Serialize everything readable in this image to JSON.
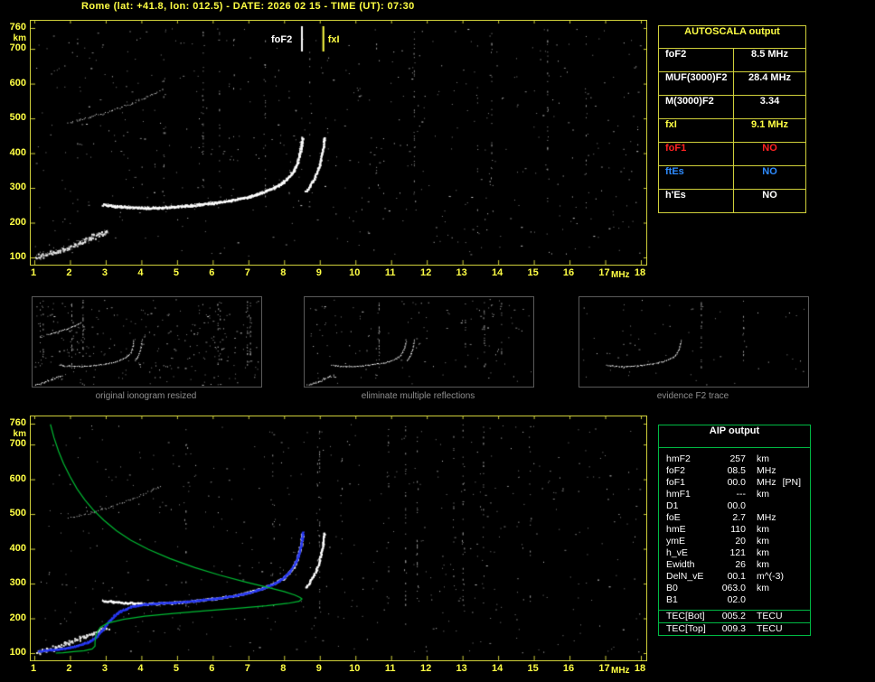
{
  "title": "Rome (lat: +41.8, lon: 012.5) - DATE: 2026 02 15 - TIME (UT): 07:30",
  "colors": {
    "axis_yellow": "#ffff44",
    "background": "#000000",
    "trace_white": "#ffffff",
    "profile_green": "#00bb33",
    "restored_blue": "#2233ee",
    "foF1_red": "#ff2222",
    "ftEs_blue": "#2e8bff"
  },
  "autoscala_table": {
    "title": "AUTOSCALA output",
    "rows": [
      {
        "label": "foF2",
        "value": "8.5 MHz",
        "color": "#ffffff"
      },
      {
        "label": "MUF(3000)F2",
        "value": "28.4 MHz",
        "color": "#ffffff"
      },
      {
        "label": "M(3000)F2",
        "value": "3.34",
        "color": "#ffffff"
      },
      {
        "label": "fxI",
        "value": "9.1 MHz",
        "color": "#ffff44"
      },
      {
        "label": "foF1",
        "value": "NO",
        "color": "#ff2222"
      },
      {
        "label": "ftEs",
        "value": "NO",
        "color": "#2e8bff"
      },
      {
        "label": "h'Es",
        "value": "NO",
        "color": "#ffffff"
      }
    ]
  },
  "aip_table": {
    "title": "AIP output",
    "rows": [
      {
        "name": "hmF2",
        "value": "257",
        "unit": "km",
        "extra": ""
      },
      {
        "name": "foF2",
        "value": "08.5",
        "unit": "MHz",
        "extra": ""
      },
      {
        "name": "foF1",
        "value": "00.0",
        "unit": "MHz",
        "extra": "[PN]"
      },
      {
        "name": "hmF1",
        "value": "---",
        "unit": "km",
        "extra": ""
      },
      {
        "name": "D1",
        "value": "00.0",
        "unit": "",
        "extra": ""
      },
      {
        "name": "foE",
        "value": "2.7",
        "unit": "MHz",
        "extra": ""
      },
      {
        "name": "hmE",
        "value": "110",
        "unit": "km",
        "extra": ""
      },
      {
        "name": "ymE",
        "value": "20",
        "unit": "km",
        "extra": ""
      },
      {
        "name": "h_vE",
        "value": "121",
        "unit": "km",
        "extra": ""
      },
      {
        "name": "Ewidth",
        "value": "26",
        "unit": "km",
        "extra": ""
      },
      {
        "name": "DelN_vE",
        "value": "00.1",
        "unit": "m^(-3)",
        "extra": ""
      },
      {
        "name": "B0",
        "value": "063.0",
        "unit": "km",
        "extra": ""
      },
      {
        "name": "B1",
        "value": "02.0",
        "unit": "",
        "extra": ""
      }
    ],
    "tec_rows": [
      {
        "name": "TEC[Bot]",
        "value": "005.2",
        "unit": "TECU"
      },
      {
        "name": "TEC[Top]",
        "value": "009.3",
        "unit": "TECU"
      }
    ]
  },
  "markers": {
    "foF2_label": "foF2",
    "fxI_label": "fxI",
    "foF2_mhz": 8.5,
    "fxI_mhz": 9.1
  },
  "thumbnails": [
    {
      "caption": "original ionogram resized"
    },
    {
      "caption": "eliminate multiple reflections"
    },
    {
      "caption": "evidence F2 trace"
    }
  ],
  "chart_data": {
    "type": "scatter",
    "xlabel": "MHz",
    "ylabel": "km",
    "xrange": [
      1,
      18
    ],
    "yrange": [
      100,
      760
    ],
    "x_ticks": [
      1,
      2,
      3,
      4,
      5,
      6,
      7,
      8,
      9,
      10,
      11,
      12,
      13,
      14,
      15,
      16,
      17,
      18
    ],
    "y_ticks": [
      100,
      200,
      300,
      400,
      500,
      600,
      700,
      760
    ],
    "traces": {
      "f2_ordinary": [
        [
          2.9,
          253
        ],
        [
          3.2,
          249
        ],
        [
          3.6,
          246
        ],
        [
          4.0,
          244
        ],
        [
          4.4,
          244
        ],
        [
          4.8,
          246
        ],
        [
          5.2,
          249
        ],
        [
          5.6,
          253
        ],
        [
          6.0,
          258
        ],
        [
          6.4,
          264
        ],
        [
          6.8,
          271
        ],
        [
          7.1,
          279
        ],
        [
          7.4,
          289
        ],
        [
          7.7,
          302
        ],
        [
          7.95,
          316
        ],
        [
          8.1,
          331
        ],
        [
          8.25,
          350
        ],
        [
          8.35,
          372
        ],
        [
          8.42,
          396
        ],
        [
          8.47,
          420
        ],
        [
          8.5,
          446
        ]
      ],
      "f2_extraordinary": [
        [
          8.6,
          290
        ],
        [
          8.7,
          305
        ],
        [
          8.8,
          322
        ],
        [
          8.9,
          344
        ],
        [
          8.98,
          368
        ],
        [
          9.04,
          394
        ],
        [
          9.08,
          420
        ],
        [
          9.11,
          448
        ]
      ],
      "second_hop": [
        [
          1.95,
          488
        ],
        [
          2.25,
          496
        ],
        [
          2.55,
          504
        ],
        [
          2.85,
          513
        ],
        [
          3.15,
          523
        ],
        [
          3.45,
          534
        ],
        [
          3.75,
          546
        ],
        [
          4.05,
          558
        ],
        [
          4.3,
          569
        ],
        [
          4.5,
          580
        ]
      ],
      "sporadic_e": [
        [
          1.05,
          103
        ],
        [
          1.25,
          108
        ],
        [
          1.45,
          114
        ],
        [
          1.65,
          120
        ],
        [
          1.85,
          127
        ],
        [
          2.05,
          135
        ],
        [
          2.25,
          143
        ],
        [
          2.45,
          152
        ],
        [
          2.65,
          161
        ],
        [
          2.85,
          169
        ],
        [
          3.05,
          176
        ]
      ],
      "restored_trace_blue": [
        [
          1.1,
          107
        ],
        [
          1.5,
          111
        ],
        [
          1.9,
          116
        ],
        [
          2.2,
          123
        ],
        [
          2.5,
          133
        ],
        [
          2.7,
          146
        ],
        [
          2.9,
          168
        ],
        [
          3.1,
          196
        ],
        [
          3.35,
          220
        ],
        [
          3.7,
          235
        ],
        [
          4.1,
          242
        ],
        [
          4.5,
          245
        ],
        [
          4.9,
          247
        ],
        [
          5.3,
          250
        ],
        [
          5.7,
          254
        ],
        [
          6.1,
          259
        ],
        [
          6.5,
          265
        ],
        [
          6.9,
          273
        ],
        [
          7.2,
          281
        ],
        [
          7.5,
          292
        ],
        [
          7.8,
          306
        ],
        [
          8.0,
          321
        ],
        [
          8.15,
          337
        ],
        [
          8.28,
          357
        ],
        [
          8.38,
          380
        ],
        [
          8.45,
          406
        ],
        [
          8.49,
          430
        ],
        [
          8.51,
          450
        ]
      ],
      "density_profile_green": [
        [
          1.45,
          758
        ],
        [
          1.55,
          720
        ],
        [
          1.68,
          680
        ],
        [
          1.82,
          645
        ],
        [
          2.0,
          608
        ],
        [
          2.2,
          572
        ],
        [
          2.42,
          540
        ],
        [
          2.65,
          512
        ],
        [
          2.95,
          482
        ],
        [
          3.3,
          452
        ],
        [
          3.7,
          425
        ],
        [
          4.2,
          398
        ],
        [
          4.8,
          372
        ],
        [
          5.5,
          346
        ],
        [
          6.2,
          324
        ],
        [
          6.9,
          305
        ],
        [
          7.5,
          290
        ],
        [
          8.0,
          277
        ],
        [
          8.3,
          267
        ],
        [
          8.45,
          260
        ],
        [
          8.5,
          256
        ],
        [
          8.42,
          249
        ],
        [
          8.1,
          243
        ],
        [
          7.5,
          236
        ],
        [
          6.7,
          229
        ],
        [
          5.8,
          222
        ],
        [
          4.9,
          214
        ],
        [
          4.1,
          206
        ],
        [
          3.5,
          197
        ],
        [
          3.05,
          186
        ],
        [
          2.85,
          174
        ],
        [
          2.76,
          160
        ],
        [
          2.72,
          146
        ],
        [
          2.7,
          132
        ],
        [
          2.7,
          120
        ],
        [
          2.62,
          112
        ],
        [
          2.4,
          107
        ],
        [
          2.1,
          104
        ],
        [
          1.8,
          101
        ],
        [
          1.6,
          100
        ]
      ]
    }
  }
}
